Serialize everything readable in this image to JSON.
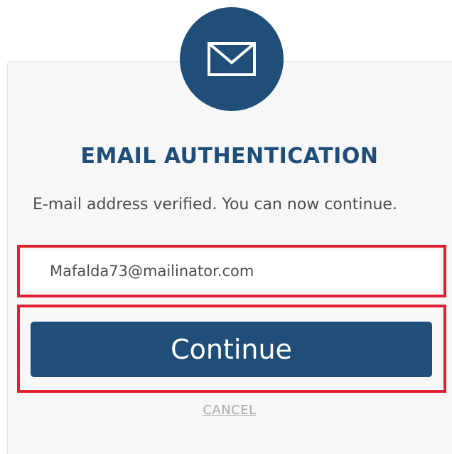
{
  "dialog": {
    "icon": "envelope-icon",
    "title": "EMAIL AUTHENTICATION",
    "message": "E-mail address verified. You can now continue.",
    "email_value": "Mafalda73@mailinator.com",
    "continue_label": "Continue",
    "cancel_label": "CANCEL"
  },
  "colors": {
    "brand": "#1f4e79",
    "highlight": "#e02030",
    "card_background": "#f7f7f7",
    "cancel_text": "#a9a9a9"
  }
}
